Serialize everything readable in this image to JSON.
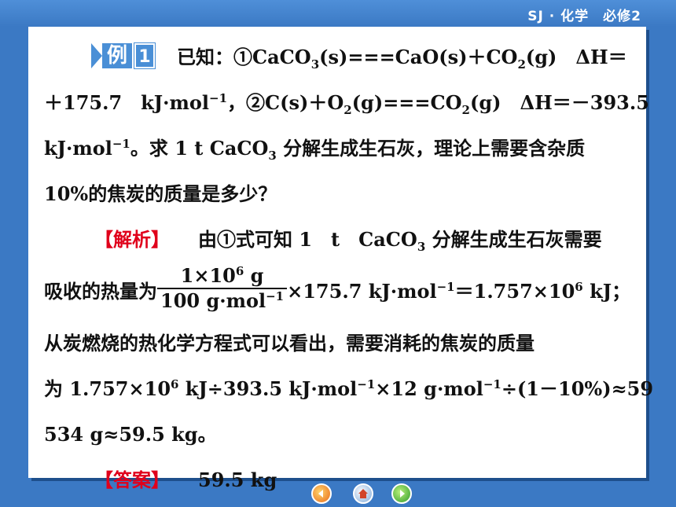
{
  "header": {
    "label": "SJ · 化学　必修2"
  },
  "example": {
    "badge_text": "例",
    "badge_number": "1",
    "q1_a": "已知：①CaCO",
    "q1_b": "(s)===CaO(s)＋CO",
    "q1_c": "(g)　ΔH＝",
    "q2_a": "＋175.7　kJ·mol",
    "q2_b": "，②C(s)＋O",
    "q2_c": "(g)===CO",
    "q2_d": "(g)　ΔH＝－393.5",
    "q3_a": "kJ·mol",
    "q3_b": "。求 1 t CaCO",
    "q3_c": " 分解生成生石灰，理论上需要含杂质",
    "q4": "10%的焦炭的质量是多少？"
  },
  "analysis": {
    "tag": "【解析】",
    "a1_a": "由①式可知 1　t　CaCO",
    "a1_b": " 分解生成生石灰需要",
    "a2_a": "吸收的热量为",
    "frac_num": "1×10",
    "frac_num_unit": " g",
    "frac_den": "100 g·mol",
    "a2_b": "×175.7 kJ·mol",
    "a2_c": "＝1.757×10",
    "a2_d": " kJ；",
    "a3": "从炭燃烧的热化学方程式可以看出，需要消耗的焦炭的质量",
    "a4_a": "为 1.757×10",
    "a4_b": " kJ÷393.5 kJ·mol",
    "a4_c": "×12 g·mol",
    "a4_d": "÷(1－10%)≈59",
    "a5": "534 g≈59.5 kg。"
  },
  "answer": {
    "tag": "【答案】",
    "value": "59.5 kg"
  },
  "sub": {
    "three": "3",
    "two": "2"
  },
  "sup": {
    "minus_one": "−1",
    "six": "6"
  },
  "nav": {
    "prev_icon": "back-arrow",
    "home_icon": "home",
    "next_icon": "forward-arrow"
  },
  "colors": {
    "background": "#3b79c4",
    "accent": "#e0001b",
    "badge": "#4a8fd6"
  }
}
